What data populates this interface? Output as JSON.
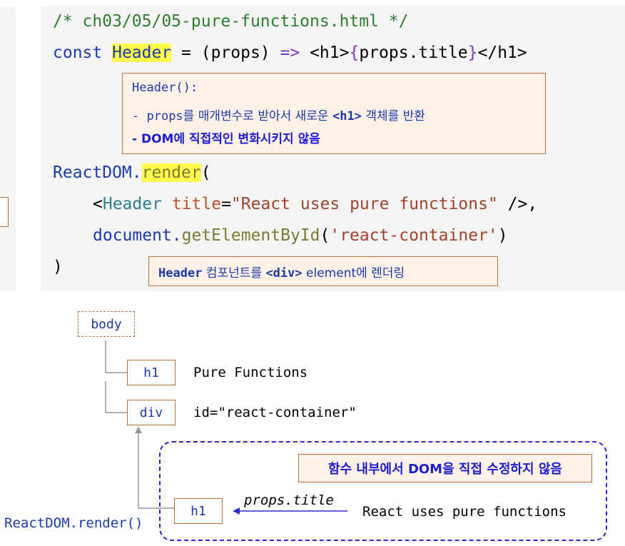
{
  "code": {
    "comment": "/* ch03/05/05-pure-functions.html */",
    "line2": {
      "kw": "const ",
      "name": "Header",
      "eq": " = (props) ",
      "arrow": "=>",
      "sp": " ",
      "tag_open": "<h1>",
      "brace_open": "{",
      "expr": "props.title",
      "brace_close": "}",
      "tag_close": "</h1>"
    },
    "note1": {
      "title": "Header():",
      "l1_dash": "- ",
      "l1_code": "props",
      "l1_text": "를 매개변수로 받아서 새로운 ",
      "l1_code2": "<h1>",
      "l1_text2": " 객체를 반환",
      "l2": "- DOM에 직접적인 변화시키지 않음"
    },
    "line3": {
      "obj": "ReactDOM.",
      "fn": "render",
      "paren": "("
    },
    "line4": {
      "open": "<",
      "tag": "Header",
      "sp": " ",
      "attr": "title",
      "eq": "=",
      "str": "\"React uses pure functions\"",
      "close": " />",
      "comma": ","
    },
    "line5": {
      "obj": "document.",
      "fn": "getElementById",
      "open": "(",
      "str": "'react-container'",
      "close": ")"
    },
    "line6": ")",
    "note2": {
      "code1": "Header",
      "text1": " 컴포넌트를 ",
      "code2": "<div>",
      "text2": " element에 렌더링"
    }
  },
  "diagram": {
    "body_node": "body",
    "h1_node": "h1",
    "h1_label": "Pure Functions",
    "div_node": "div",
    "div_label": "id=\"react-container\"",
    "render_label": "ReactDOM.render()",
    "h1_new_node": "h1",
    "props_label": "props.title",
    "react_label": "React uses pure functions",
    "callout": "함수 내부에서 DOM을 직접 수정하지 않음"
  },
  "colors": {
    "code_bg": "#f5f5f5",
    "note_bg": "#fdf1e8",
    "note_border": "#c0703a",
    "highlight": "#fffb4d",
    "dashed_blue": "#2b2bd6"
  }
}
